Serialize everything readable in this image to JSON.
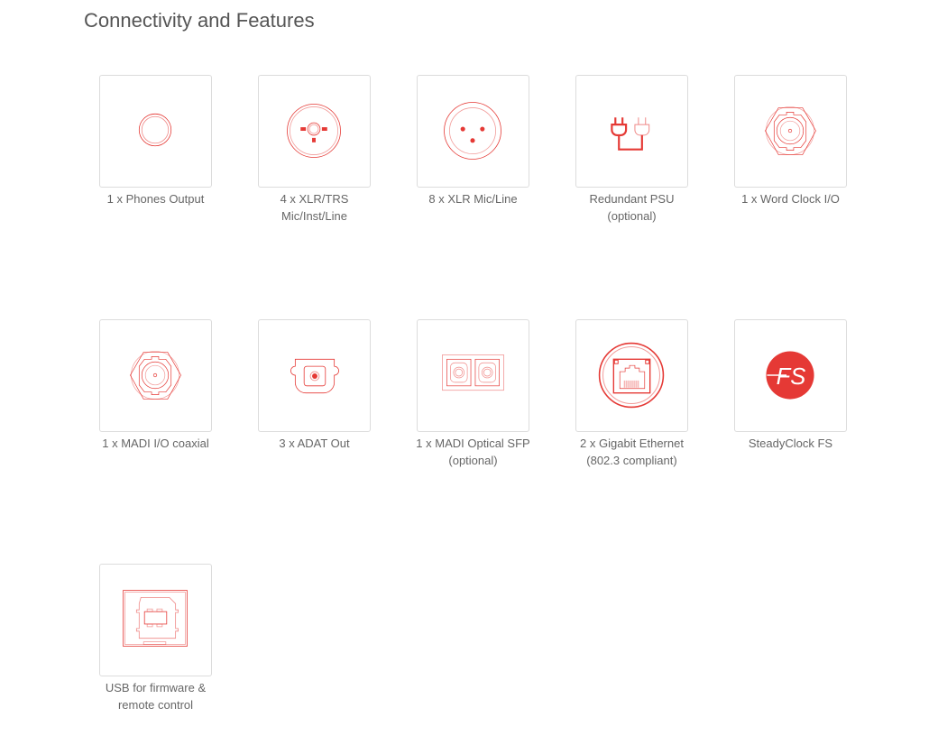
{
  "page": {
    "title": "Connectivity and Features"
  },
  "accent_color": "#e53935",
  "features": [
    {
      "icon": "phones-jack-icon",
      "line1": "1 x Phones Output",
      "line2": ""
    },
    {
      "icon": "xlr-trs-combo-icon",
      "line1": "4 x XLR/TRS",
      "line2": "Mic/Inst/Line"
    },
    {
      "icon": "xlr-icon",
      "line1": "8 x XLR Mic/Line",
      "line2": ""
    },
    {
      "icon": "power-plug-icon",
      "line1": "Redundant PSU",
      "line2": "(optional)"
    },
    {
      "icon": "bnc-icon",
      "line1": "1 x Word Clock I/O",
      "line2": ""
    },
    {
      "icon": "bnc-coax-icon",
      "line1": "1 x MADI I/O coaxial",
      "line2": ""
    },
    {
      "icon": "optical-toslink-icon",
      "line1": "3 x ADAT Out",
      "line2": ""
    },
    {
      "icon": "sfp-optical-icon",
      "line1": "1 x MADI Optical SFP",
      "line2": "(optional)"
    },
    {
      "icon": "ethernet-rj45-icon",
      "line1": "2 x Gigabit Ethernet",
      "line2": "(802.3 compliant)"
    },
    {
      "icon": "steadyclock-fs-icon",
      "line1": "SteadyClock FS",
      "line2": "",
      "logo_text": "FS"
    },
    {
      "icon": "usb-b-icon",
      "line1": "USB for firmware &",
      "line2": "remote control"
    }
  ]
}
